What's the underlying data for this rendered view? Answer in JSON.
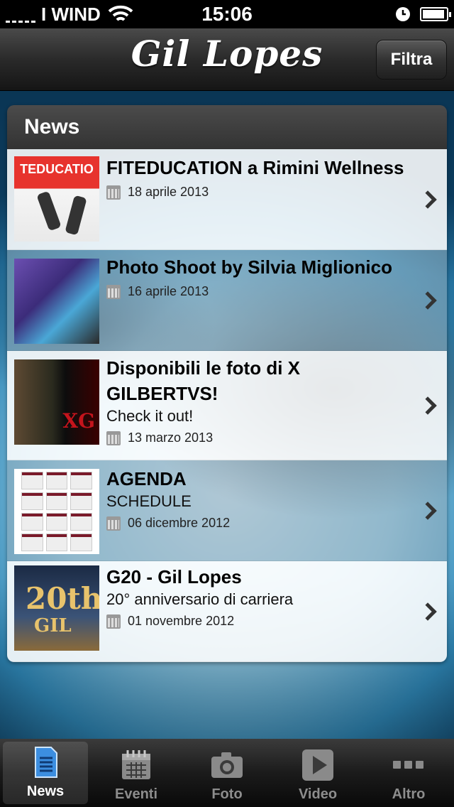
{
  "status_bar": {
    "carrier": "I WIND",
    "time": "15:06"
  },
  "nav": {
    "title": "Gil Lopes",
    "filter_button": "Filtra"
  },
  "section": {
    "title": "News"
  },
  "news": [
    {
      "title": "FITEDUCATION a Rimini Wellness",
      "subtitle": "",
      "date": "18 aprile 2013",
      "thumb_text": "TEDUCATIO"
    },
    {
      "title": "Photo Shoot by Silvia Miglionico",
      "subtitle": "",
      "date": "16 aprile 2013"
    },
    {
      "title": "Disponibili le foto di X GILBERTVS!",
      "subtitle": "Check it out!",
      "date": "13 marzo 2013",
      "thumb_text": "XG"
    },
    {
      "title": "AGENDA",
      "subtitle": "SCHEDULE",
      "date": "06 dicembre 2012"
    },
    {
      "title": "G20 - Gil Lopes",
      "subtitle": "20° anniversario di carriera",
      "date": "01 novembre 2012",
      "thumb_text": "20th",
      "thumb_text2": "GIL"
    }
  ],
  "tabs": [
    {
      "label": "News",
      "icon": "document-icon",
      "active": true
    },
    {
      "label": "Eventi",
      "icon": "calendar-icon",
      "active": false
    },
    {
      "label": "Foto",
      "icon": "camera-icon",
      "active": false
    },
    {
      "label": "Video",
      "icon": "play-icon",
      "active": false
    },
    {
      "label": "Altro",
      "icon": "more-icon",
      "active": false
    }
  ],
  "colors": {
    "nav_bg": "#2a2a2a",
    "header_bg": "#3d3d3d",
    "active_tab_icon": "#3c8ee0"
  }
}
